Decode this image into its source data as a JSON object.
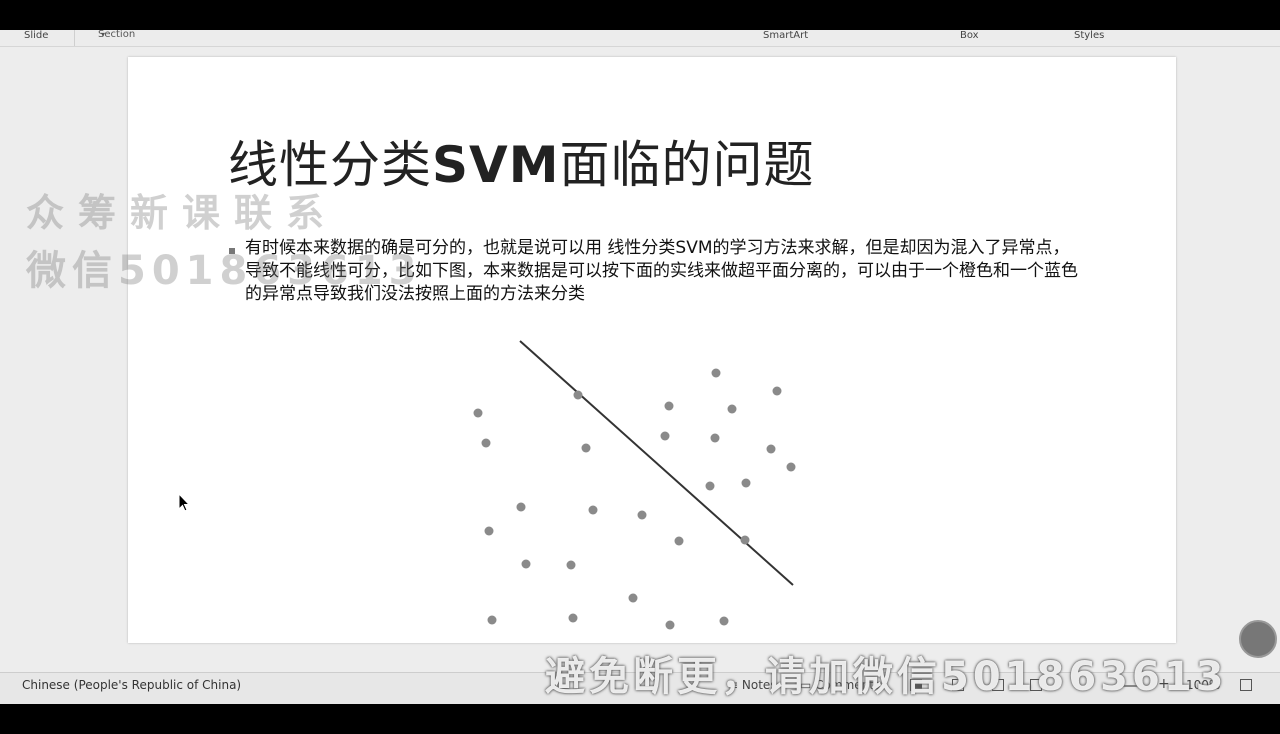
{
  "ribbon": {
    "slide_label": "Slide",
    "section_label": "Section",
    "smartart_label": "SmartArt",
    "box_label": "Box",
    "styles_label": "Styles"
  },
  "slide": {
    "title_prefix": "线性分类",
    "title_bold": "SVM",
    "title_suffix": "面临的问题",
    "bullet_text": "有时候本来数据的确是可分的，也就是说可以用 线性分类SVM的学习方法来求解，但是却因为混入了异常点，导致不能线性可分，比如下图，本来数据是可以按下面的实线来做超平面分离的，可以由于一个橙色和一个蓝色的异常点导致我们没法按照上面的方法来分类",
    "bullet_icon": "square-bullet-icon"
  },
  "figure": {
    "point_color": "#8a8a8a",
    "line_color": "#333333"
  },
  "watermarks": {
    "line1": "众筹新课联系",
    "line2": "微信501863613",
    "bottom": "避免断更，请加微信501863613"
  },
  "statusbar": {
    "language": "Chinese (People's Republic of China)",
    "notes_label": "Notes",
    "comments_label": "Comments",
    "zoom": "100%"
  }
}
